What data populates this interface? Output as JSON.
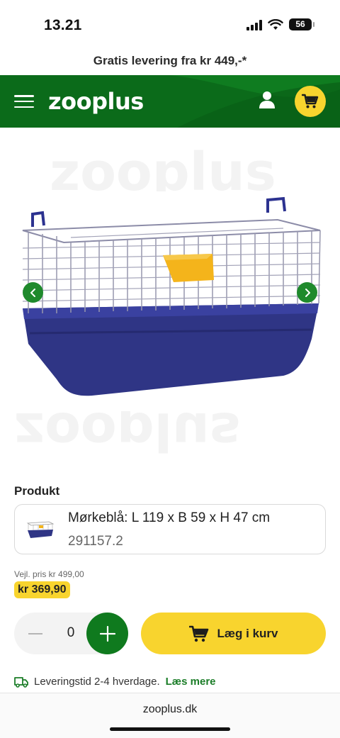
{
  "status": {
    "time": "13.21",
    "battery": "56"
  },
  "promo": {
    "text": "Gratis levering fra kr 449,-*"
  },
  "header": {
    "logo": "zooplus",
    "menu_icon": "hamburger-menu-icon",
    "account_icon": "user-icon",
    "cart_icon": "shopping-cart-icon",
    "brand_color": "#0b6b1a",
    "accent_color": "#f8d42e"
  },
  "gallery": {
    "watermark_top": "zooplus",
    "watermark_bottom": "zooplus",
    "prev_icon": "chevron-left-icon",
    "next_icon": "chevron-right-icon"
  },
  "product": {
    "section_label": "Produkt",
    "variant_name": "Mørkeblå: L 119 x B 59 x H 47 cm",
    "variant_sku": "291157.2"
  },
  "pricing": {
    "rrp": "Vejl. pris kr 499,00",
    "price": "kr 369,90"
  },
  "cart": {
    "quantity": "0",
    "add_label": "Læg i kurv"
  },
  "delivery": {
    "text": "Leveringstid 2-4 hverdage.",
    "link": "Læs mere",
    "icon": "delivery-truck-icon"
  },
  "browser": {
    "url": "zooplus.dk"
  }
}
